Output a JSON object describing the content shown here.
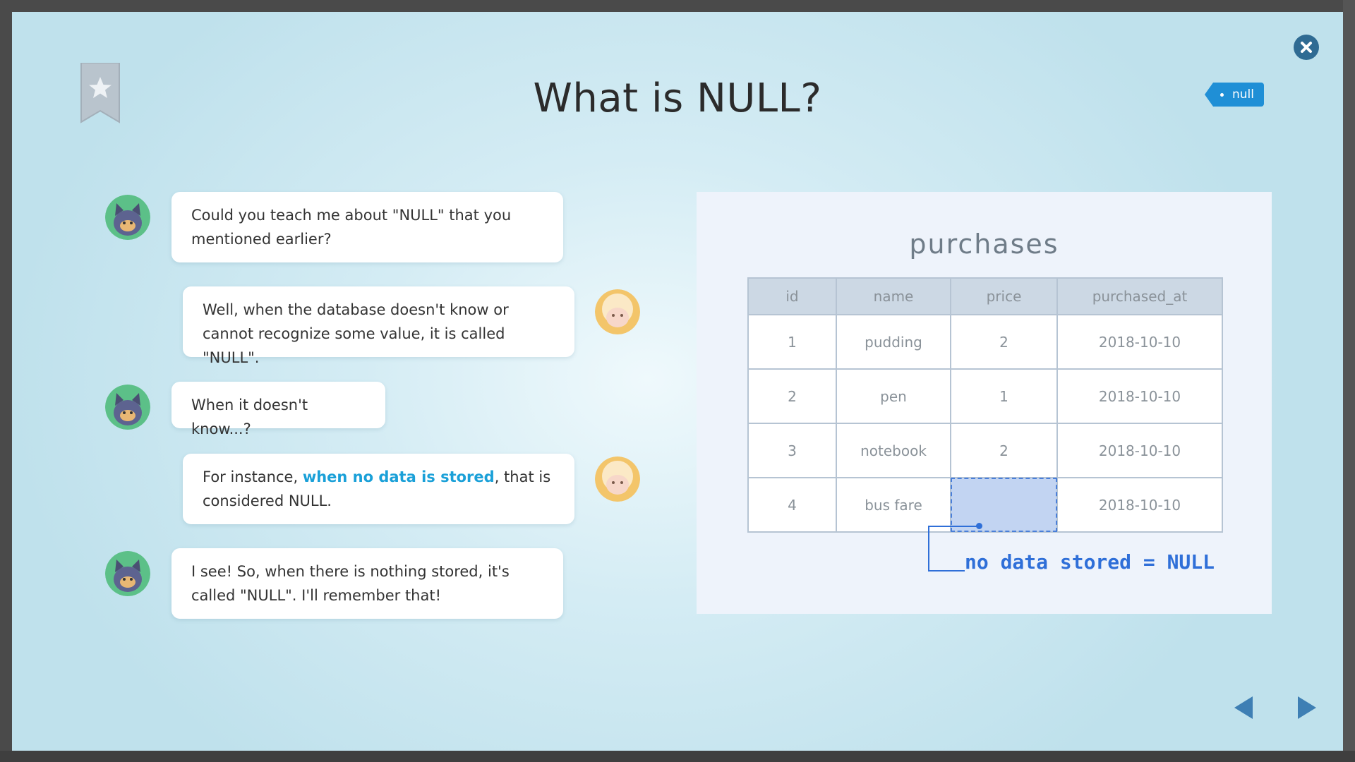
{
  "modal": {
    "title": "What is NULL?",
    "tag_label": "null"
  },
  "chat": [
    {
      "speaker": "cat",
      "text": "Could you teach me about \"NULL\" that you mentioned earlier?"
    },
    {
      "speaker": "sheep",
      "text": "Well, when the database doesn't know or cannot recognize some value, it is called \"NULL\"."
    },
    {
      "speaker": "cat",
      "text": "When it doesn't know...?"
    },
    {
      "speaker": "sheep",
      "text_before": "For instance, ",
      "text_highlight": "when no data is stored",
      "text_after": ", that is considered NULL."
    },
    {
      "speaker": "cat",
      "text": "I see! So, when there is nothing stored, it's called \"NULL\". I'll remember that!"
    }
  ],
  "table": {
    "name": "purchases",
    "columns": [
      "id",
      "name",
      "price",
      "purchased_at"
    ],
    "rows": [
      [
        "1",
        "pudding",
        "2",
        "2018-10-10"
      ],
      [
        "2",
        "pen",
        "1",
        "2018-10-10"
      ],
      [
        "3",
        "notebook",
        "2",
        "2018-10-10"
      ],
      [
        "4",
        "bus fare",
        "",
        "2018-10-10"
      ]
    ],
    "callout": "no data stored = NULL"
  },
  "colors": {
    "accent": "#1f8fd6",
    "highlight": "#1aa0d8",
    "callout": "#2f6fd8",
    "null_cell": "#c2d4f2"
  }
}
